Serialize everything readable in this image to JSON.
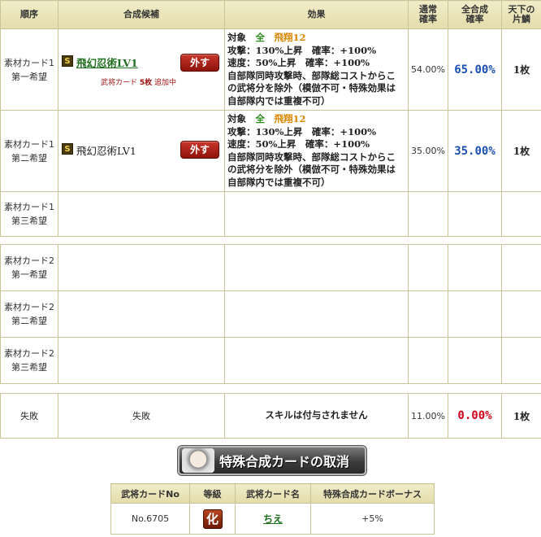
{
  "headers": {
    "order": "順序",
    "candidate": "合成候補",
    "effect": "効果",
    "normal_rate": "通常\n確率",
    "total_rate": "全合成\n確率",
    "half": "天下の\n片鱗"
  },
  "rows": [
    {
      "order": "素材カード1\n第一希望",
      "badge": "S",
      "skill": "飛幻忍術LV1",
      "remove_label": "外す",
      "adding": {
        "pre": "武将カード ",
        "count": "5枚",
        "post": " 追加中"
      },
      "effect": {
        "target_label": "対象　",
        "target_all": "全",
        "target_type": "　飛翔12",
        "lines": [
          "攻撃：130%上昇　確率：+100%",
          "速度：50%上昇　確率：+100%",
          "自部隊同時攻撃時、部隊総コストからこ",
          "の武将分を除外（模倣不可・特殊効果は",
          "自部隊内では重複不可）"
        ]
      },
      "normal_rate": "54.00%",
      "total_rate": "65.00%",
      "half": "1枚"
    },
    {
      "order": "素材カード1\n第二希望",
      "badge": "S",
      "skill": "飛幻忍術LV1",
      "remove_label": "外す",
      "effect": {
        "target_label": "対象　",
        "target_all": "全",
        "target_type": "　飛翔12",
        "lines": [
          "攻撃：130%上昇　確率：+100%",
          "速度：50%上昇　確率：+100%",
          "自部隊同時攻撃時、部隊総コストからこ",
          "の武将分を除外（模倣不可・特殊効果は",
          "自部隊内では重複不可）"
        ]
      },
      "normal_rate": "35.00%",
      "total_rate": "35.00%",
      "half": "1枚"
    },
    {
      "order": "素材カード1\n第三希望"
    },
    {
      "order": "素材カード2\n第一希望"
    },
    {
      "order": "素材カード2\n第二希望"
    },
    {
      "order": "素材カード2\n第三希望"
    }
  ],
  "fail": {
    "order": "失敗",
    "candidate": "失敗",
    "effect": "スキルは付与されません",
    "normal_rate": "11.00%",
    "total_rate": "0.00%",
    "half": "1枚"
  },
  "cancel_button": "特殊合成カードの取消",
  "sub_table": {
    "headers": [
      "武将カードNo",
      "等級",
      "武将カード名",
      "特殊合成カードボーナス"
    ],
    "row": {
      "no": "No.6705",
      "rank": "化",
      "name": "ちえ",
      "bonus": "+5%"
    }
  },
  "colors": {
    "accent_green": "#2e8b1e",
    "accent_orange": "#d98600",
    "rate_blue": "#1b4fb3",
    "rate_red": "#d0001a",
    "remove_red": "#b5271c"
  }
}
